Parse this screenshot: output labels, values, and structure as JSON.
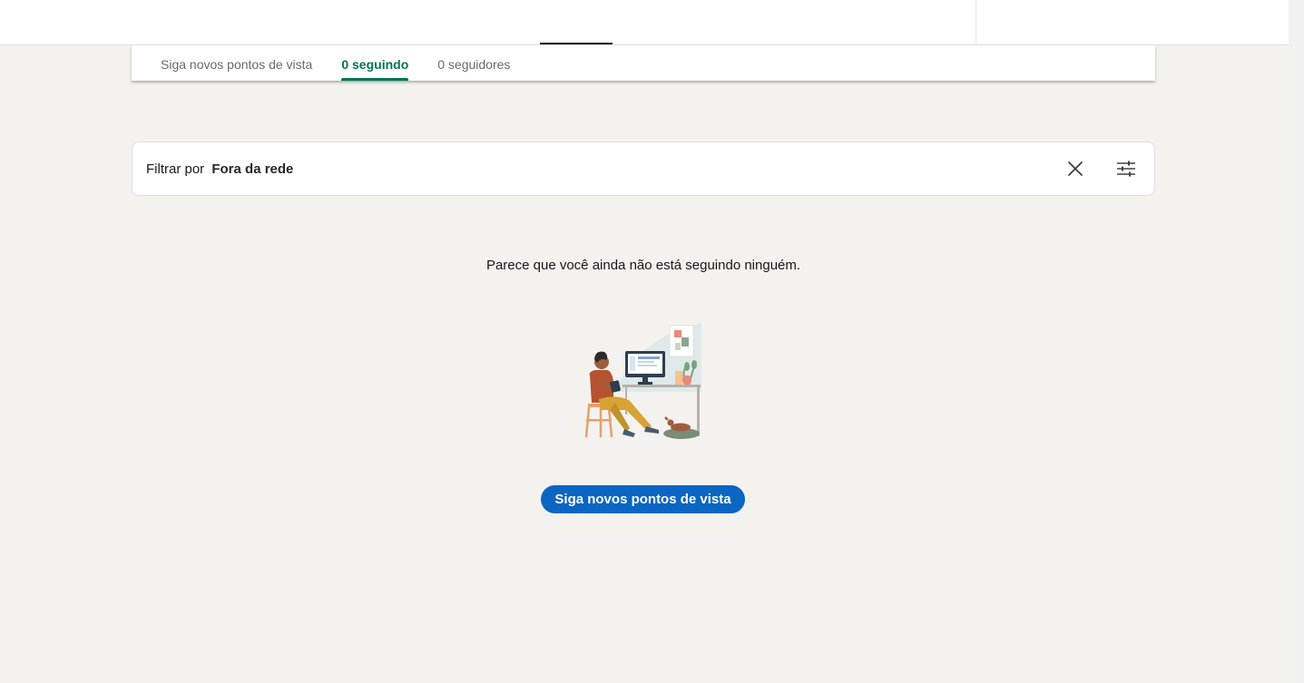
{
  "tabs": [
    {
      "label": "Siga novos pontos de vista",
      "active": false
    },
    {
      "label": "0 seguindo",
      "active": true
    },
    {
      "label": "0 seguidores",
      "active": false
    }
  ],
  "filter": {
    "prefix": "Filtrar por",
    "value": "Fora da rede",
    "clear_icon": "close-icon",
    "settings_icon": "sliders-icon"
  },
  "empty_state": {
    "message": "Parece que você ainda não está seguindo ninguém.",
    "illustration": "person-at-desk-illustration",
    "button_label": "Siga novos pontos de vista"
  },
  "colors": {
    "accent_green": "#01754f",
    "primary_blue": "#0a66c2",
    "background": "#f3f2ef"
  }
}
